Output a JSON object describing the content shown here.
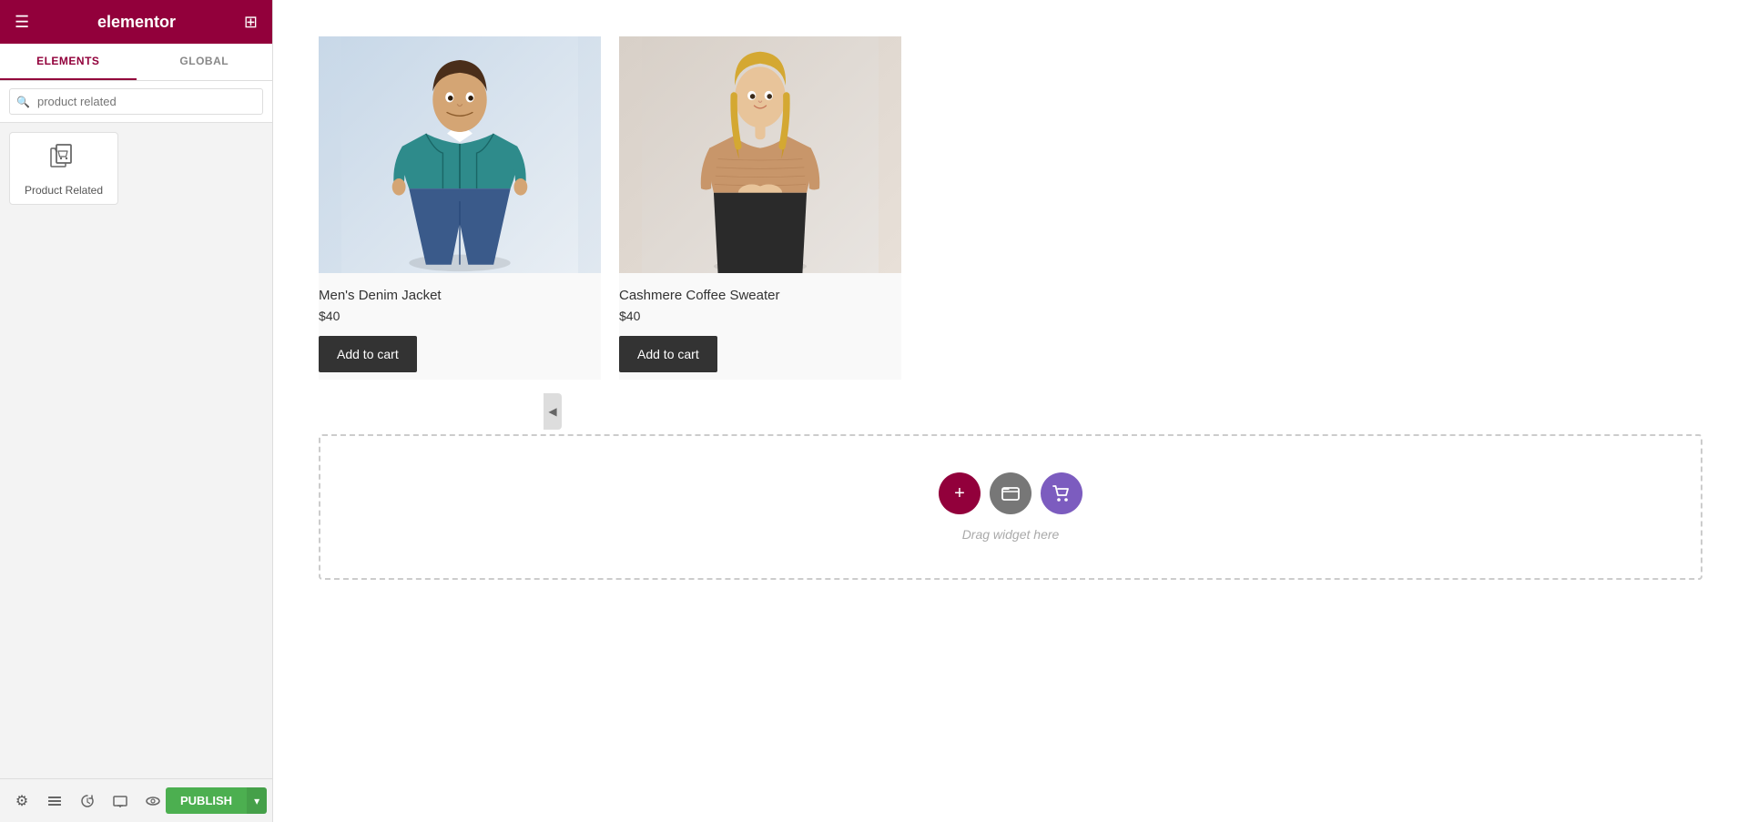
{
  "header": {
    "logo": "elementor",
    "hamburger_icon": "☰",
    "grid_icon": "⊞"
  },
  "sidebar": {
    "tabs": [
      {
        "id": "elements",
        "label": "ELEMENTS",
        "active": true
      },
      {
        "id": "global",
        "label": "GLOBAL",
        "active": false
      }
    ],
    "search": {
      "placeholder": "product related",
      "value": "product related"
    },
    "widgets": [
      {
        "id": "product-related",
        "label": "Product Related",
        "icon": "widget-product-related"
      }
    ]
  },
  "bottom_toolbar": {
    "icons": [
      {
        "id": "settings",
        "icon": "⚙"
      },
      {
        "id": "layers",
        "icon": "≡"
      },
      {
        "id": "history",
        "icon": "↺"
      },
      {
        "id": "responsive",
        "icon": "▭"
      },
      {
        "id": "eye",
        "icon": "👁"
      }
    ],
    "publish_label": "PUBLISH",
    "publish_arrow": "▾"
  },
  "canvas": {
    "products": [
      {
        "id": "product-1",
        "name": "Men's Denim Jacket",
        "price": "$40",
        "image_type": "man",
        "button_label": "Add to cart"
      },
      {
        "id": "product-2",
        "name": "Cashmere Coffee Sweater",
        "price": "$40",
        "image_type": "woman",
        "button_label": "Add to cart"
      }
    ],
    "drop_zone": {
      "label": "Drag widget here",
      "icons": [
        {
          "id": "add",
          "icon": "+",
          "type": "add"
        },
        {
          "id": "folder",
          "icon": "▣",
          "type": "folder"
        },
        {
          "id": "cart",
          "icon": "☺",
          "type": "cart"
        }
      ]
    }
  },
  "panel_toggle": {
    "icon": "◀"
  }
}
